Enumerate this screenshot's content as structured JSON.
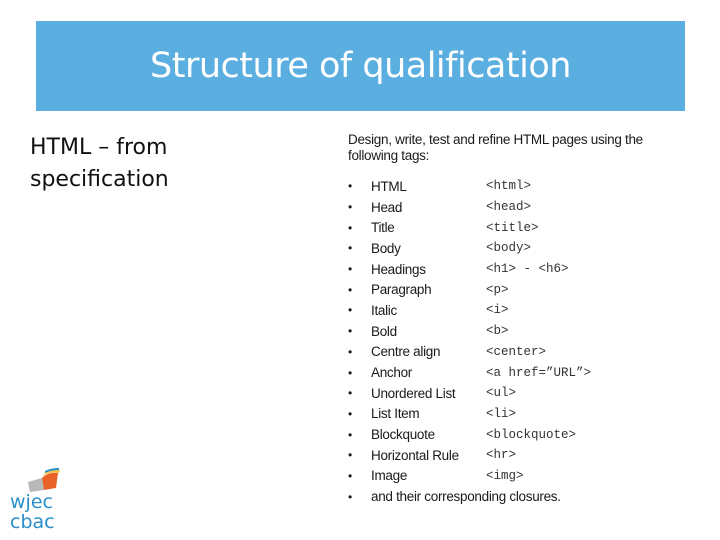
{
  "header": {
    "title": "Structure of qualification"
  },
  "left": {
    "text": "HTML – from specification"
  },
  "spec": {
    "intro": "Design, write, test and refine HTML pages using the following tags:",
    "items": [
      {
        "name": "HTML",
        "tag": "<html>"
      },
      {
        "name": "Head",
        "tag": "<head>"
      },
      {
        "name": "Title",
        "tag": "<title>"
      },
      {
        "name": "Body",
        "tag": "<body>"
      },
      {
        "name": "Headings",
        "tag": "<h1> - <h6>"
      },
      {
        "name": "Paragraph",
        "tag": "<p>"
      },
      {
        "name": "Italic",
        "tag": "<i>"
      },
      {
        "name": "Bold",
        "tag": "<b>"
      },
      {
        "name": "Centre align",
        "tag": "<center>"
      },
      {
        "name": "Anchor",
        "tag": "<a href=”URL”>"
      },
      {
        "name": "Unordered List",
        "tag": "<ul>"
      },
      {
        "name": "List Item",
        "tag": "<li>"
      },
      {
        "name": "Blockquote",
        "tag": "<blockquote>"
      },
      {
        "name": "Horizontal Rule",
        "tag": "<hr>"
      },
      {
        "name": "Image",
        "tag": "<img>"
      }
    ],
    "closing": "and their corresponding closures.",
    "bullet": "•"
  },
  "logo": {
    "line1": "wjec",
    "line2": "cbac"
  },
  "colors": {
    "title_bar": "#5aaee0",
    "logo_text": "#2a8fc9",
    "logo_orange": "#e8622a",
    "logo_yellow": "#f5c244",
    "logo_gray": "#b8b8b8"
  }
}
